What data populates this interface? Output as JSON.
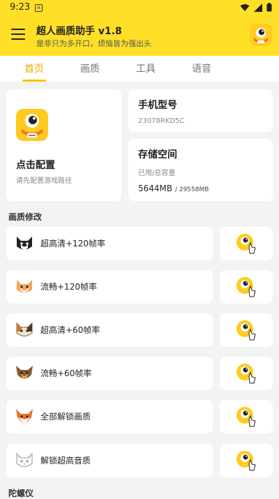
{
  "status_bar": {
    "time": "9:23",
    "notification_letter": "A"
  },
  "app_bar": {
    "title": "超人画质助手 v1.8",
    "subtitle": "是非只为多开口，烦恼皆为强出头"
  },
  "tabs": [
    {
      "label": "首页",
      "active": true
    },
    {
      "label": "画质",
      "active": false
    },
    {
      "label": "工具",
      "active": false
    },
    {
      "label": "语音",
      "active": false
    }
  ],
  "config_card": {
    "title": "点击配置",
    "subtitle": "请先配置游戏路径"
  },
  "phone_card": {
    "title": "手机型号",
    "value": "23078RKD5C"
  },
  "storage_card": {
    "title": "存储空间",
    "label": "已用/总容量",
    "used": "5644MB",
    "separator": "/ ",
    "total": "29558MB"
  },
  "quality_section": {
    "title": "画质修改",
    "items": [
      {
        "label": "超高清+120帧率",
        "icon": "tuxedo-cat-icon"
      },
      {
        "label": "流畅+120帧率",
        "icon": "orange-cat-icon"
      },
      {
        "label": "超高清+60帧率",
        "icon": "calico-cat-icon"
      },
      {
        "label": "流畅+60帧率",
        "icon": "yorkie-dog-icon"
      },
      {
        "label": "全部解锁画质",
        "icon": "fox-icon"
      },
      {
        "label": "解锁超高音质",
        "icon": "white-cat-icon"
      }
    ]
  },
  "gyro_section": {
    "title": "陀螺仪"
  },
  "colors": {
    "brand_yellow": "#ffe026",
    "tab_active": "#f0a800",
    "background": "#f3f3f3"
  }
}
